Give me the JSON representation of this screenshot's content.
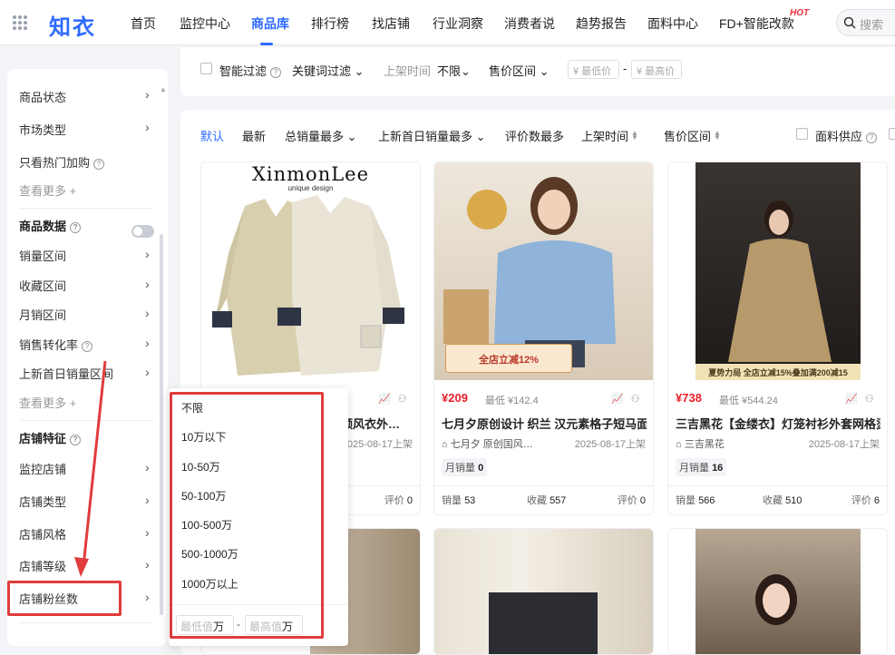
{
  "app": {
    "logo": "知衣",
    "search_placeholder": "搜索"
  },
  "nav": {
    "items": [
      "首页",
      "监控中心",
      "商品库",
      "排行榜",
      "找店铺",
      "行业洞察",
      "消费者说",
      "趋势报告",
      "面料中心",
      "FD+智能改款"
    ],
    "active": "商品库",
    "hot_badge": "HOT"
  },
  "sidebar": {
    "rows": [
      {
        "label": "商品状态",
        "arrow": "›"
      },
      {
        "label": "市场类型",
        "arrow": "›"
      },
      {
        "label": "只看热门加购",
        "help": "?"
      },
      {
        "label": "查看更多 +"
      },
      {
        "label": "商品数据",
        "help": "?"
      },
      {
        "label": "销量区间",
        "arrow": "›"
      },
      {
        "label": "收藏区间",
        "arrow": "›"
      },
      {
        "label": "月销区间",
        "arrow": "›"
      },
      {
        "label": "销售转化率",
        "help": "?",
        "arrow": "›"
      },
      {
        "label": "上新首日销量区间",
        "arrow": "›"
      },
      {
        "label": "查看更多 +"
      },
      {
        "label": "店铺特征",
        "help": "?"
      },
      {
        "label": "监控店铺",
        "arrow": "›"
      },
      {
        "label": "店铺类型",
        "arrow": "›"
      },
      {
        "label": "店铺风格",
        "arrow": "›"
      },
      {
        "label": "店铺等级",
        "arrow": "›"
      },
      {
        "label": "店铺粉丝数",
        "arrow": "›"
      }
    ]
  },
  "filterbar": {
    "smart_filter": "智能过滤",
    "smart_help": "?",
    "keyword_filter": "关键词过滤",
    "launch_time_label": "上架时间",
    "launch_time_value": "不限",
    "price_range": "售价区间",
    "min_price": "¥ 最低价",
    "max_price": "¥ 最高价",
    "dash": "-"
  },
  "sortbar": {
    "items": [
      "默认",
      "最新",
      "总销量最多",
      "上新首日销量最多",
      "评价数最多",
      "上架时间",
      "售价区间"
    ],
    "active": "默认",
    "fabric_supply": "面料供应",
    "fabric_help": "?"
  },
  "cards": [
    {
      "brand": "XinmonLee",
      "brand_sub": "unique design",
      "price": "",
      "low_price": "",
      "title": "领风衣外…",
      "shop": "",
      "date": "025-08-17上架",
      "monthly_label": "",
      "monthly_value": "",
      "sales_label": "",
      "sales": "",
      "fav_label": "",
      "fav": "",
      "reviews_label": "评价",
      "reviews": "0"
    },
    {
      "banner": "全店立减12%",
      "price": "¥209",
      "low_price": "最低 ¥142.4",
      "title": "七月夕原创设计 织兰 汉元素格子短马面…",
      "shop": "七月夕 原创国风…",
      "date": "2025-08-17上架",
      "monthly_label": "月销量",
      "monthly_value": "0",
      "sales_label": "销量",
      "sales": "53",
      "fav_label": "收藏",
      "fav": "557",
      "reviews_label": "评价",
      "reviews": "0"
    },
    {
      "banner": "夏势力局   全店立减15%叠加满200减15",
      "price": "¥738",
      "low_price": "最低 ¥544.24",
      "title": "三吉黑花【金缕衣】灯笼衬衫外套网格烫…",
      "shop": "三吉黑花",
      "date": "2025-08-17上架",
      "monthly_label": "月销量",
      "monthly_value": "16",
      "sales_label": "销量",
      "sales": "566",
      "fav_label": "收藏",
      "fav": "510",
      "reviews_label": "评价",
      "reviews": "6"
    }
  ],
  "dropdown": {
    "options": [
      "不限",
      "10万以下",
      "10-50万",
      "50-100万",
      "100-500万",
      "500-1000万",
      "1000万以上"
    ],
    "min_placeholder": "最低值",
    "max_placeholder": "最高值",
    "unit": "万",
    "dash": "-"
  },
  "colors": {
    "accent": "#2f6bff",
    "price_red": "#e8202a",
    "highlight": "#e03c3c"
  }
}
